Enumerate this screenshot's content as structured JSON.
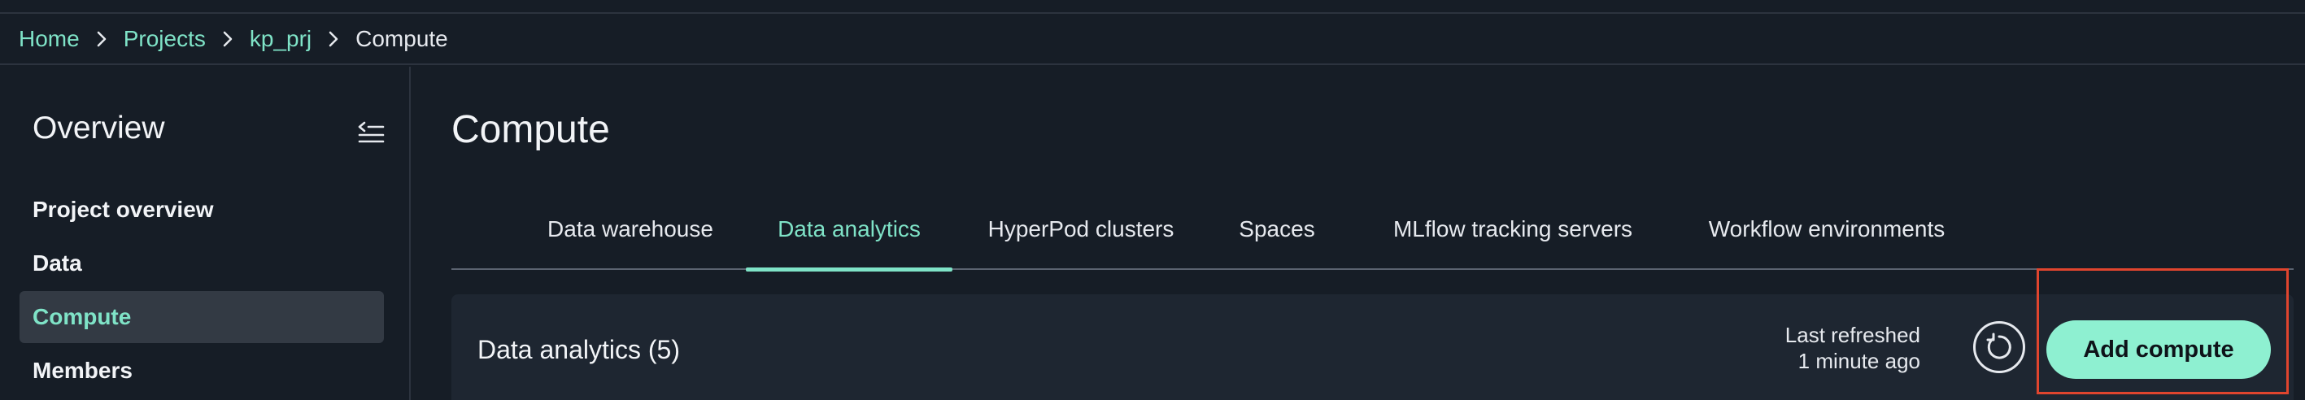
{
  "breadcrumb": {
    "items": [
      {
        "label": "Home"
      },
      {
        "label": "Projects"
      },
      {
        "label": "kp_prj"
      }
    ],
    "current": "Compute"
  },
  "sidebar": {
    "title": "Overview",
    "items": [
      {
        "label": "Project overview",
        "active": false
      },
      {
        "label": "Data",
        "active": false
      },
      {
        "label": "Compute",
        "active": true
      },
      {
        "label": "Members",
        "active": false
      }
    ]
  },
  "page": {
    "title": "Compute"
  },
  "tabs": [
    {
      "label": "Data warehouse",
      "active": false
    },
    {
      "label": "Data analytics",
      "active": true
    },
    {
      "label": "HyperPod clusters",
      "active": false
    },
    {
      "label": "Spaces",
      "active": false
    },
    {
      "label": "MLflow tracking servers",
      "active": false
    },
    {
      "label": "Workflow environments",
      "active": false
    }
  ],
  "panel": {
    "title": "Data analytics (5)",
    "refresh_line1": "Last refreshed",
    "refresh_line2": "1 minute ago",
    "add_button": "Add compute"
  },
  "colors": {
    "accent": "#7fe3c7",
    "button_bg": "#8ef0d1",
    "background": "#161d26",
    "panel_bg": "#1e2631",
    "highlight": "#e0452e"
  },
  "icons": {
    "breadcrumb_separator": "chevron-right-icon",
    "collapse": "collapse-sidebar-icon",
    "refresh": "refresh-icon"
  }
}
